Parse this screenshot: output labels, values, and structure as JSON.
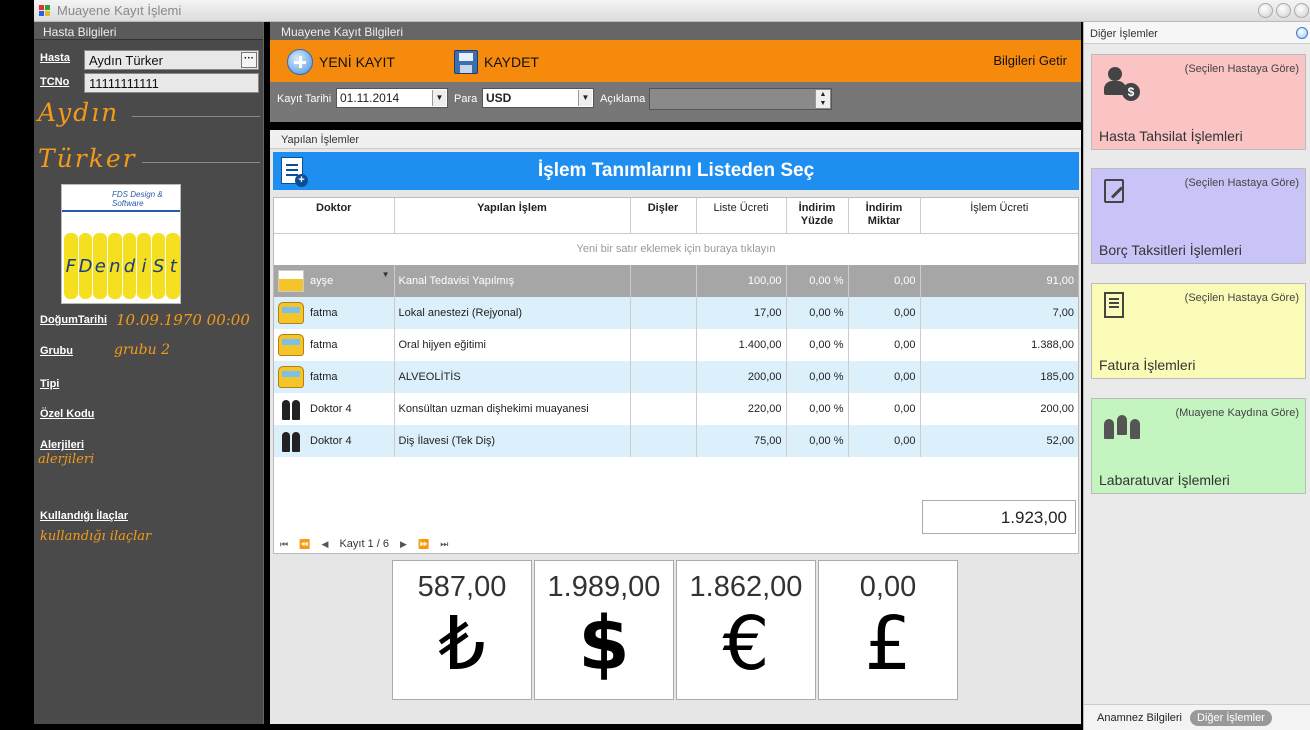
{
  "window": {
    "title": "Muayene Kayıt İşlemi"
  },
  "patient": {
    "header": "Hasta Bilgileri",
    "hasta_label": "Hasta",
    "hasta_value": "Aydın Türker",
    "tc_label": "TCNo",
    "tc_value": "11111111111",
    "first_name": "Aydın",
    "last_name": "Türker",
    "logo_brand": "FDS Design & Software",
    "logo_letters": [
      "F",
      "D",
      "e",
      "n",
      "d",
      "i",
      "S",
      "t"
    ],
    "dob_label": "DoğumTarihi",
    "dob_value": "10.09.1970 00:00",
    "group_label": "Grubu",
    "group_value": "grubu 2",
    "type_label": "Tipi",
    "code_label": "Özel Kodu",
    "allergy_label": "Alerjileri",
    "allergy_value": "alerjileri",
    "meds_label": "Kullandığı İlaçlar",
    "meds_value": "kullandığı ilaçlar"
  },
  "exam": {
    "header": "Muayene Kayıt Bilgileri",
    "new_label": "YENİ KAYIT",
    "save_label": "KAYDET",
    "fetch_label": "Bilgileri Getir",
    "date_label": "Kayıt Tarihi",
    "date_value": "01.11.2014",
    "currency_label": "Para",
    "currency_value": "USD",
    "note_label": "Açıklama"
  },
  "ops": {
    "header": "Yapılan İşlemler",
    "pick_label": "İşlem Tanımlarını Listeden Seç",
    "columns": [
      "Doktor",
      "Yapılan İşlem",
      "Dişler",
      "Liste Ücreti",
      "İndirim Yüzde",
      "İndirim Miktar",
      "İşlem Ücreti"
    ],
    "new_row_hint": "Yeni bir satır eklemek için buraya tıklayın",
    "rows": [
      {
        "icon": "tooth",
        "doctor": "ayşe",
        "proc": "Kanal Tedavisi Yapılmış",
        "teeth": "",
        "list": "100,00",
        "pct": "0,00 %",
        "amt": "0,00",
        "fee": "91,00"
      },
      {
        "icon": "bus",
        "doctor": "fatma",
        "proc": "Lokal anestezi (Rejyonal)",
        "teeth": "",
        "list": "17,00",
        "pct": "0,00 %",
        "amt": "0,00",
        "fee": "7,00"
      },
      {
        "icon": "bus",
        "doctor": "fatma",
        "proc": "Oral hijyen eğitimi",
        "teeth": "",
        "list": "1.400,00",
        "pct": "0,00 %",
        "amt": "0,00",
        "fee": "1.388,00"
      },
      {
        "icon": "bus",
        "doctor": "fatma",
        "proc": "ALVEOLİTİS",
        "teeth": "",
        "list": "200,00",
        "pct": "0,00 %",
        "amt": "0,00",
        "fee": "185,00"
      },
      {
        "icon": "people",
        "doctor": "Doktor 4",
        "proc": "Konsültan uzman dişhekimi muayanesi",
        "teeth": "",
        "list": "220,00",
        "pct": "0,00 %",
        "amt": "0,00",
        "fee": "200,00"
      },
      {
        "icon": "people",
        "doctor": "Doktor 4",
        "proc": "Diş İlavesi (Tek Diş)",
        "teeth": "",
        "list": "75,00",
        "pct": "0,00 %",
        "amt": "0,00",
        "fee": "52,00"
      }
    ],
    "total": "1.923,00",
    "pager_text": "Kayıt 1 / 6"
  },
  "currencies": [
    {
      "amount": "587,00",
      "symbol": "₺"
    },
    {
      "amount": "1.989,00",
      "symbol": "$"
    },
    {
      "amount": "1.862,00",
      "symbol": "€"
    },
    {
      "amount": "0,00",
      "symbol": "£"
    }
  ],
  "other": {
    "header": "Diğer İşlemler",
    "tiles": [
      {
        "sub": "(Seçilen Hastaya Göre)",
        "name": "Hasta Tahsilat İşlemleri",
        "color": "#fbc4c4",
        "icon": "money"
      },
      {
        "sub": "(Seçilen Hastaya Göre)",
        "name": "Borç Taksitleri İşlemleri",
        "color": "#c8c4f8",
        "icon": "edit"
      },
      {
        "sub": "(Seçilen Hastaya Göre)",
        "name": "Fatura İşlemleri",
        "color": "#fbfbb8",
        "icon": "book"
      },
      {
        "sub": "(Muayene Kaydına Göre)",
        "name": "Labaratuvar İşlemleri",
        "color": "#c4f4c0",
        "icon": "people"
      }
    ],
    "tab_anamnez": "Anamnez Bilgileri",
    "tab_other": "Diğer İşlemler"
  }
}
